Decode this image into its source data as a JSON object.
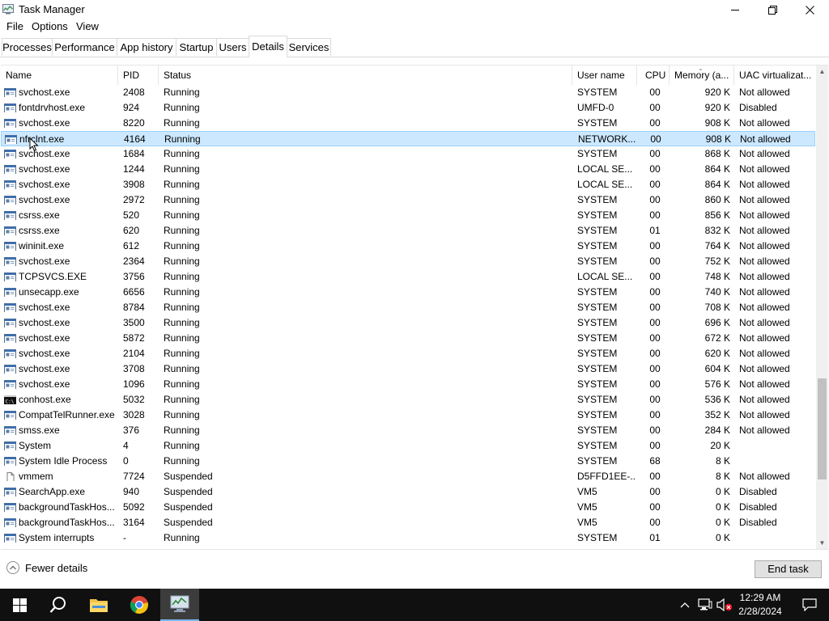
{
  "window": {
    "title": "Task Manager",
    "menu": [
      "File",
      "Options",
      "View"
    ],
    "tabs": [
      "Processes",
      "Performance",
      "App history",
      "Startup",
      "Users",
      "Details",
      "Services"
    ],
    "active_tab": "Details"
  },
  "table": {
    "columns": [
      "Name",
      "PID",
      "Status",
      "User name",
      "CPU",
      "Memory (a...",
      "UAC virtualizat..."
    ],
    "sorted_column": "Memory (a...",
    "selected_row": 3,
    "rows": [
      {
        "icon": "service-icon",
        "name": "svchost.exe",
        "pid": "2408",
        "status": "Running",
        "user": "SYSTEM",
        "cpu": "00",
        "mem": "920 K",
        "uac": "Not allowed"
      },
      {
        "icon": "service-icon",
        "name": "fontdrvhost.exe",
        "pid": "924",
        "status": "Running",
        "user": "UMFD-0",
        "cpu": "00",
        "mem": "920 K",
        "uac": "Disabled"
      },
      {
        "icon": "service-icon",
        "name": "svchost.exe",
        "pid": "8220",
        "status": "Running",
        "user": "SYSTEM",
        "cpu": "00",
        "mem": "908 K",
        "uac": "Not allowed"
      },
      {
        "icon": "service-icon",
        "name": "nfrclnt.exe",
        "pid": "4164",
        "status": "Running",
        "user": "NETWORK...",
        "cpu": "00",
        "mem": "908 K",
        "uac": "Not allowed"
      },
      {
        "icon": "service-icon",
        "name": "svchost.exe",
        "pid": "1684",
        "status": "Running",
        "user": "SYSTEM",
        "cpu": "00",
        "mem": "868 K",
        "uac": "Not allowed"
      },
      {
        "icon": "service-icon",
        "name": "svchost.exe",
        "pid": "1244",
        "status": "Running",
        "user": "LOCAL SE...",
        "cpu": "00",
        "mem": "864 K",
        "uac": "Not allowed"
      },
      {
        "icon": "service-icon",
        "name": "svchost.exe",
        "pid": "3908",
        "status": "Running",
        "user": "LOCAL SE...",
        "cpu": "00",
        "mem": "864 K",
        "uac": "Not allowed"
      },
      {
        "icon": "service-icon",
        "name": "svchost.exe",
        "pid": "2972",
        "status": "Running",
        "user": "SYSTEM",
        "cpu": "00",
        "mem": "860 K",
        "uac": "Not allowed"
      },
      {
        "icon": "service-icon",
        "name": "csrss.exe",
        "pid": "520",
        "status": "Running",
        "user": "SYSTEM",
        "cpu": "00",
        "mem": "856 K",
        "uac": "Not allowed"
      },
      {
        "icon": "service-icon",
        "name": "csrss.exe",
        "pid": "620",
        "status": "Running",
        "user": "SYSTEM",
        "cpu": "01",
        "mem": "832 K",
        "uac": "Not allowed"
      },
      {
        "icon": "service-icon",
        "name": "wininit.exe",
        "pid": "612",
        "status": "Running",
        "user": "SYSTEM",
        "cpu": "00",
        "mem": "764 K",
        "uac": "Not allowed"
      },
      {
        "icon": "service-icon",
        "name": "svchost.exe",
        "pid": "2364",
        "status": "Running",
        "user": "SYSTEM",
        "cpu": "00",
        "mem": "752 K",
        "uac": "Not allowed"
      },
      {
        "icon": "service-icon",
        "name": "TCPSVCS.EXE",
        "pid": "3756",
        "status": "Running",
        "user": "LOCAL SE...",
        "cpu": "00",
        "mem": "748 K",
        "uac": "Not allowed"
      },
      {
        "icon": "service-icon",
        "name": "unsecapp.exe",
        "pid": "6656",
        "status": "Running",
        "user": "SYSTEM",
        "cpu": "00",
        "mem": "740 K",
        "uac": "Not allowed"
      },
      {
        "icon": "service-icon",
        "name": "svchost.exe",
        "pid": "8784",
        "status": "Running",
        "user": "SYSTEM",
        "cpu": "00",
        "mem": "708 K",
        "uac": "Not allowed"
      },
      {
        "icon": "service-icon",
        "name": "svchost.exe",
        "pid": "3500",
        "status": "Running",
        "user": "SYSTEM",
        "cpu": "00",
        "mem": "696 K",
        "uac": "Not allowed"
      },
      {
        "icon": "service-icon",
        "name": "svchost.exe",
        "pid": "5872",
        "status": "Running",
        "user": "SYSTEM",
        "cpu": "00",
        "mem": "672 K",
        "uac": "Not allowed"
      },
      {
        "icon": "service-icon",
        "name": "svchost.exe",
        "pid": "2104",
        "status": "Running",
        "user": "SYSTEM",
        "cpu": "00",
        "mem": "620 K",
        "uac": "Not allowed"
      },
      {
        "icon": "service-icon",
        "name": "svchost.exe",
        "pid": "3708",
        "status": "Running",
        "user": "SYSTEM",
        "cpu": "00",
        "mem": "604 K",
        "uac": "Not allowed"
      },
      {
        "icon": "service-icon",
        "name": "svchost.exe",
        "pid": "1096",
        "status": "Running",
        "user": "SYSTEM",
        "cpu": "00",
        "mem": "576 K",
        "uac": "Not allowed"
      },
      {
        "icon": "console-icon",
        "name": "conhost.exe",
        "pid": "5032",
        "status": "Running",
        "user": "SYSTEM",
        "cpu": "00",
        "mem": "536 K",
        "uac": "Not allowed"
      },
      {
        "icon": "service-icon",
        "name": "CompatTelRunner.exe",
        "pid": "3028",
        "status": "Running",
        "user": "SYSTEM",
        "cpu": "00",
        "mem": "352 K",
        "uac": "Not allowed"
      },
      {
        "icon": "service-icon",
        "name": "smss.exe",
        "pid": "376",
        "status": "Running",
        "user": "SYSTEM",
        "cpu": "00",
        "mem": "284 K",
        "uac": "Not allowed"
      },
      {
        "icon": "service-icon",
        "name": "System",
        "pid": "4",
        "status": "Running",
        "user": "SYSTEM",
        "cpu": "00",
        "mem": "20 K",
        "uac": ""
      },
      {
        "icon": "service-icon",
        "name": "System Idle Process",
        "pid": "0",
        "status": "Running",
        "user": "SYSTEM",
        "cpu": "68",
        "mem": "8 K",
        "uac": ""
      },
      {
        "icon": "file-icon",
        "name": "vmmem",
        "pid": "7724",
        "status": "Suspended",
        "user": "D5FFD1EE-...",
        "cpu": "00",
        "mem": "8 K",
        "uac": "Not allowed"
      },
      {
        "icon": "service-icon",
        "name": "SearchApp.exe",
        "pid": "940",
        "status": "Suspended",
        "user": "VM5",
        "cpu": "00",
        "mem": "0 K",
        "uac": "Disabled"
      },
      {
        "icon": "service-icon",
        "name": "backgroundTaskHos...",
        "pid": "5092",
        "status": "Suspended",
        "user": "VM5",
        "cpu": "00",
        "mem": "0 K",
        "uac": "Disabled"
      },
      {
        "icon": "service-icon",
        "name": "backgroundTaskHos...",
        "pid": "3164",
        "status": "Suspended",
        "user": "VM5",
        "cpu": "00",
        "mem": "0 K",
        "uac": "Disabled"
      },
      {
        "icon": "service-icon",
        "name": "System interrupts",
        "pid": "-",
        "status": "Running",
        "user": "SYSTEM",
        "cpu": "01",
        "mem": "0 K",
        "uac": ""
      }
    ]
  },
  "scrollbar": {
    "position": 0.84,
    "visible_fraction": 0.22
  },
  "footer": {
    "fewer_details": "Fewer details",
    "end_task": "End task"
  },
  "taskbar": {
    "pinned": [
      "windows-start-icon",
      "search-icon",
      "file-explorer-icon",
      "chrome-icon",
      "task-manager-icon"
    ],
    "time": "12:29 AM",
    "date": "2/28/2024"
  },
  "colors": {
    "selection": "#cce8ff",
    "selection_border": "#99d1ff",
    "taskbar": "#101010",
    "active_indicator": "#76b9ed"
  }
}
